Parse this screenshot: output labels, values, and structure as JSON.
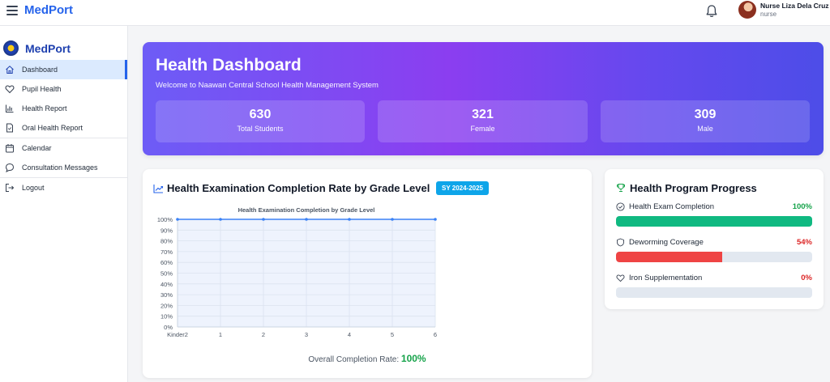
{
  "topbar": {
    "brand": "MedPort",
    "user_name": "Nurse Liza Dela Cruz",
    "user_role": "nurse"
  },
  "sidebar": {
    "brand": "MedPort",
    "items": [
      {
        "label": "Dashboard",
        "icon": "home-icon",
        "active": true
      },
      {
        "label": "Pupil Health",
        "icon": "heart-icon"
      },
      {
        "label": "Health Report",
        "icon": "bar-chart-icon"
      },
      {
        "label": "Oral Health Report",
        "icon": "document-icon"
      },
      {
        "label": "Calendar",
        "icon": "calendar-icon"
      },
      {
        "label": "Consultation Messages",
        "icon": "chat-icon"
      },
      {
        "label": "Logout",
        "icon": "logout-icon"
      }
    ]
  },
  "hero": {
    "title": "Health Dashboard",
    "subtitle": "Welcome to Naawan Central School Health Management System",
    "stats": [
      {
        "value": "630",
        "label": "Total Students"
      },
      {
        "value": "321",
        "label": "Female"
      },
      {
        "value": "309",
        "label": "Male"
      }
    ]
  },
  "chart_card": {
    "title": "Health Examination Completion Rate by Grade Level",
    "badge": "SY 2024-2025",
    "overall_label": "Overall Completion Rate:",
    "overall_value": "100%"
  },
  "chart_data": {
    "type": "line",
    "title": "Health Examination Completion by Grade Level",
    "categories": [
      "Kinder2",
      "1",
      "2",
      "3",
      "4",
      "5",
      "6"
    ],
    "series": [
      {
        "values": [
          100,
          100,
          100,
          100,
          100,
          100,
          100
        ]
      }
    ],
    "yticks": [
      "0%",
      "10%",
      "20%",
      "30%",
      "40%",
      "50%",
      "60%",
      "70%",
      "80%",
      "90%",
      "100%"
    ],
    "ylim": [
      0,
      100
    ],
    "grid": true,
    "color": "#3b82f6"
  },
  "progress_card": {
    "title": "Health Program Progress",
    "items": [
      {
        "label": "Health Exam Completion",
        "pct_text": "100%",
        "value": 100,
        "color": "#10b981",
        "pct_color": "#16a34a",
        "icon": "check-circle-icon"
      },
      {
        "label": "Deworming Coverage",
        "pct_text": "54%",
        "value": 54,
        "color": "#ef4444",
        "pct_color": "#dc2626",
        "icon": "shield-icon"
      },
      {
        "label": "Iron Supplementation",
        "pct_text": "0%",
        "value": 0,
        "color": "#ef4444",
        "pct_color": "#dc2626",
        "icon": "heart-icon"
      }
    ]
  },
  "colors": {
    "brand": "#2563eb",
    "badge": "#0ea5e9",
    "success": "#16a34a",
    "danger": "#dc2626"
  }
}
